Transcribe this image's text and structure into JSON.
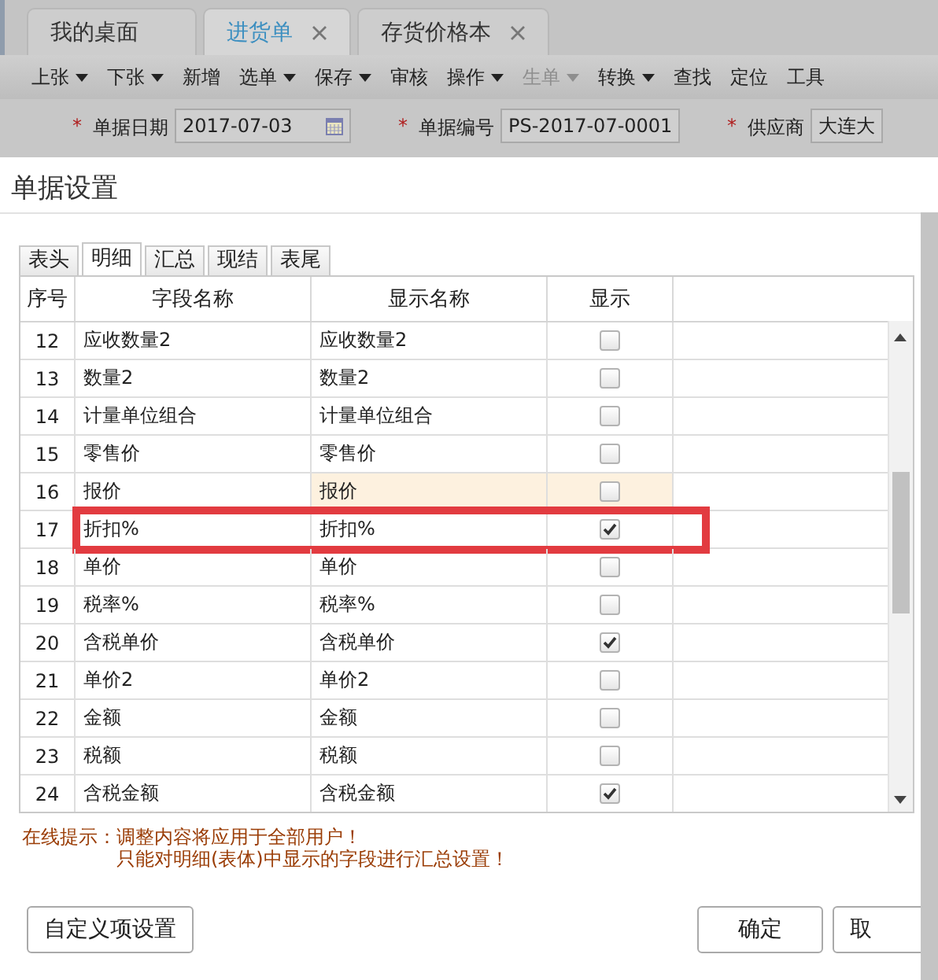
{
  "app_tabs": [
    {
      "label": "我的桌面",
      "selected": false,
      "closable": false
    },
    {
      "label": "进货单",
      "selected": true,
      "closable": true
    },
    {
      "label": "存货价格本",
      "selected": false,
      "closable": true
    }
  ],
  "toolbar": [
    {
      "label": "上张",
      "dropdown": true,
      "disabled": false
    },
    {
      "label": "下张",
      "dropdown": true,
      "disabled": false
    },
    {
      "label": "新增",
      "dropdown": false,
      "disabled": false
    },
    {
      "label": "选单",
      "dropdown": true,
      "disabled": false
    },
    {
      "label": "保存",
      "dropdown": true,
      "disabled": false
    },
    {
      "label": "审核",
      "dropdown": false,
      "disabled": false
    },
    {
      "label": "操作",
      "dropdown": true,
      "disabled": false
    },
    {
      "label": "生单",
      "dropdown": true,
      "disabled": true
    },
    {
      "label": "转换",
      "dropdown": true,
      "disabled": false
    },
    {
      "label": "查找",
      "dropdown": false,
      "disabled": false
    },
    {
      "label": "定位",
      "dropdown": false,
      "disabled": false
    },
    {
      "label": "工具",
      "dropdown": false,
      "disabled": false
    }
  ],
  "form_fields": [
    {
      "label": "单据日期",
      "required_mark": "*",
      "value": "2017-07-03",
      "kind": "date"
    },
    {
      "label": "单据编号",
      "required_mark": "*",
      "value": "PS-2017-07-0001",
      "kind": "text"
    },
    {
      "label": "供应商",
      "required_mark": "*",
      "value": "大连大",
      "kind": "text"
    }
  ],
  "dialog": {
    "title": "单据设置",
    "tabs": [
      {
        "label": "表头",
        "selected": false
      },
      {
        "label": "明细",
        "selected": true
      },
      {
        "label": "汇总",
        "selected": false
      },
      {
        "label": "现结",
        "selected": false
      },
      {
        "label": "表尾",
        "selected": false
      }
    ],
    "table": {
      "columns": [
        "序号",
        "字段名称",
        "显示名称",
        "显示"
      ],
      "rows": [
        {
          "no": "12",
          "field": "应收数量2",
          "display": "应收数量2",
          "shown": false,
          "highlighted": false,
          "marked": false
        },
        {
          "no": "13",
          "field": "数量2",
          "display": "数量2",
          "shown": false,
          "highlighted": false,
          "marked": false
        },
        {
          "no": "14",
          "field": "计量单位组合",
          "display": "计量单位组合",
          "shown": false,
          "highlighted": false,
          "marked": false
        },
        {
          "no": "15",
          "field": "零售价",
          "display": "零售价",
          "shown": false,
          "highlighted": false,
          "marked": false
        },
        {
          "no": "16",
          "field": "报价",
          "display": "报价",
          "shown": false,
          "highlighted": true,
          "marked": false
        },
        {
          "no": "17",
          "field": "折扣%",
          "display": "折扣%",
          "shown": true,
          "highlighted": false,
          "marked": true
        },
        {
          "no": "18",
          "field": "单价",
          "display": "单价",
          "shown": false,
          "highlighted": false,
          "marked": false
        },
        {
          "no": "19",
          "field": "税率%",
          "display": "税率%",
          "shown": false,
          "highlighted": false,
          "marked": false
        },
        {
          "no": "20",
          "field": "含税单价",
          "display": "含税单价",
          "shown": true,
          "highlighted": false,
          "marked": false
        },
        {
          "no": "21",
          "field": "单价2",
          "display": "单价2",
          "shown": false,
          "highlighted": false,
          "marked": false
        },
        {
          "no": "22",
          "field": "金额",
          "display": "金额",
          "shown": false,
          "highlighted": false,
          "marked": false
        },
        {
          "no": "23",
          "field": "税额",
          "display": "税额",
          "shown": false,
          "highlighted": false,
          "marked": false
        },
        {
          "no": "24",
          "field": "含税金额",
          "display": "含税金额",
          "shown": true,
          "highlighted": false,
          "marked": false
        }
      ]
    },
    "hint_label": "在线提示：",
    "hints": [
      "调整内容将应用于全部用户！",
      "只能对明细(表体)中显示的字段进行汇总设置！"
    ],
    "buttons": [
      {
        "label": "自定义项设置",
        "kind": "left"
      },
      {
        "label": "确定",
        "kind": "right"
      },
      {
        "label": "取",
        "kind": "right"
      }
    ]
  }
}
